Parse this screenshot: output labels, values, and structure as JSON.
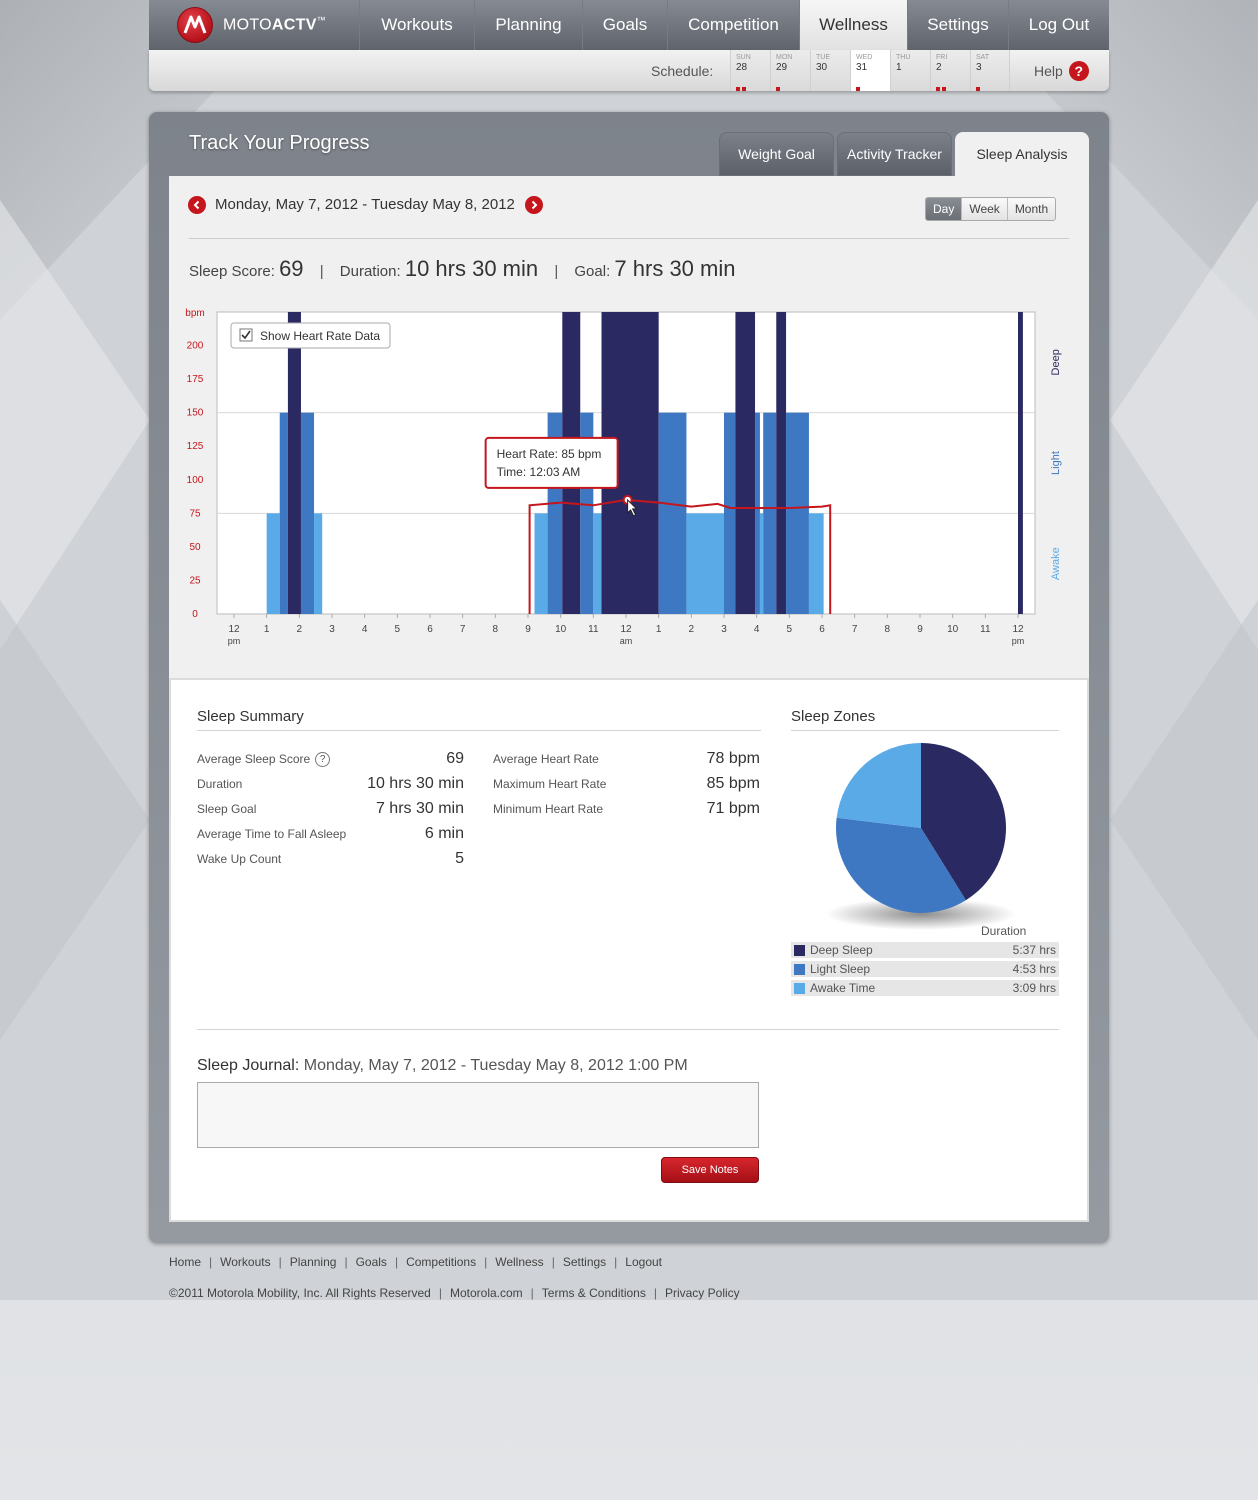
{
  "brand": {
    "name_prefix": "MOTO",
    "name_bold": "ACTV",
    "trademark": "™"
  },
  "nav": {
    "items": [
      "Workouts",
      "Planning",
      "Goals",
      "Competition",
      "Wellness",
      "Settings",
      "Log Out"
    ],
    "active": "Wellness"
  },
  "schedule": {
    "label": "Schedule:",
    "days": [
      {
        "name": "SUN",
        "num": "28",
        "dots": 2
      },
      {
        "name": "MON",
        "num": "29",
        "dots": 1
      },
      {
        "name": "TUE",
        "num": "30",
        "dots": 0
      },
      {
        "name": "WED",
        "num": "31",
        "dots": 1,
        "today": true
      },
      {
        "name": "THU",
        "num": "1",
        "dots": 0
      },
      {
        "name": "FRI",
        "num": "2",
        "dots": 2
      },
      {
        "name": "SAT",
        "num": "3",
        "dots": 1
      }
    ],
    "help_label": "Help",
    "help_icon": "?"
  },
  "page": {
    "title": "Track Your Progress",
    "tabs": [
      "Weight Goal",
      "Activity Tracker",
      "Sleep Analysis"
    ],
    "active_tab": "Sleep Analysis"
  },
  "date_range": "Monday, May 7, 2012 - Tuesday May 8, 2012",
  "periods": [
    "Day",
    "Week",
    "Month"
  ],
  "active_period": "Day",
  "stats": {
    "score_label": "Sleep Score:",
    "score_value": "69",
    "duration_label": "Duration:",
    "duration_value": "10 hrs 30 min",
    "goal_label": "Goal:",
    "goal_value": "7 hrs 30 min",
    "separator": "|"
  },
  "chart_data": {
    "type": "bar",
    "y_axis_label": "bpm",
    "y_ticks": [
      0,
      25,
      50,
      75,
      100,
      125,
      150,
      175,
      200
    ],
    "ylim": [
      0,
      225
    ],
    "x_ticks": [
      "12",
      "1",
      "2",
      "3",
      "4",
      "5",
      "6",
      "7",
      "8",
      "9",
      "10",
      "11",
      "12",
      "1",
      "2",
      "3",
      "4",
      "5",
      "6",
      "7",
      "8",
      "9",
      "10",
      "11",
      "12"
    ],
    "x_subtitles": {
      "0": "pm",
      "12": "am",
      "24": "pm"
    },
    "zones": [
      "Awake",
      "Light",
      "Deep"
    ],
    "zone_levels": {
      "Awake": 1,
      "Light": 2,
      "Deep": 3
    },
    "colors": {
      "Awake": "#5aaae8",
      "Light": "#3e78c2",
      "Deep": "#2a2962",
      "heart": "#c4161c"
    },
    "segments": [
      {
        "start": 1.0,
        "end": 1.4,
        "zone": "Awake"
      },
      {
        "start": 1.4,
        "end": 1.65,
        "zone": "Light"
      },
      {
        "start": 1.65,
        "end": 2.05,
        "zone": "Deep"
      },
      {
        "start": 2.05,
        "end": 2.45,
        "zone": "Light"
      },
      {
        "start": 2.45,
        "end": 2.7,
        "zone": "Awake"
      },
      {
        "start": 9.2,
        "end": 9.6,
        "zone": "Awake"
      },
      {
        "start": 9.6,
        "end": 10.05,
        "zone": "Light"
      },
      {
        "start": 10.05,
        "end": 10.6,
        "zone": "Deep"
      },
      {
        "start": 10.6,
        "end": 11.0,
        "zone": "Light"
      },
      {
        "start": 11.0,
        "end": 11.25,
        "zone": "Awake"
      },
      {
        "start": 11.25,
        "end": 13.0,
        "zone": "Deep"
      },
      {
        "start": 13.0,
        "end": 13.85,
        "zone": "Light"
      },
      {
        "start": 13.85,
        "end": 15.0,
        "zone": "Awake"
      },
      {
        "start": 15.0,
        "end": 15.35,
        "zone": "Light"
      },
      {
        "start": 15.35,
        "end": 15.95,
        "zone": "Deep"
      },
      {
        "start": 15.95,
        "end": 16.1,
        "zone": "Light"
      },
      {
        "start": 16.1,
        "end": 16.2,
        "zone": "Awake"
      },
      {
        "start": 16.2,
        "end": 16.6,
        "zone": "Light"
      },
      {
        "start": 16.6,
        "end": 16.9,
        "zone": "Deep"
      },
      {
        "start": 16.9,
        "end": 17.6,
        "zone": "Light"
      },
      {
        "start": 17.6,
        "end": 18.05,
        "zone": "Awake"
      },
      {
        "start": 24.0,
        "end": 24.15,
        "zone": "Deep"
      }
    ],
    "heart_rate": {
      "x": [
        9.05,
        9.05,
        10.0,
        11.0,
        12.0,
        13.0,
        14.0,
        14.8,
        15.2,
        16.0,
        17.0,
        18.0,
        18.25,
        18.25
      ],
      "y": [
        0,
        81,
        83,
        81,
        85,
        83,
        80,
        82,
        79,
        79,
        79,
        80,
        81,
        0
      ]
    },
    "show_heart_rate_label": "Show Heart Rate Data",
    "show_heart_rate_checked": true,
    "tooltip": {
      "heart_rate_label": "Heart Rate:",
      "heart_rate_value": "85 bpm",
      "time_label": "Time:",
      "time_value": "12:03 AM",
      "x": 12.05,
      "y": 85
    }
  },
  "summary": {
    "title": "Sleep Summary",
    "left": [
      {
        "label": "Average Sleep Score",
        "value": "69",
        "help": true
      },
      {
        "label": "Duration",
        "value": "10 hrs 30 min"
      },
      {
        "label": "Sleep Goal",
        "value": "7 hrs 30 min"
      },
      {
        "label": "Average Time to Fall Asleep",
        "value": "6 min"
      },
      {
        "label": "Wake Up Count",
        "value": "5"
      }
    ],
    "right": [
      {
        "label": "Average Heart Rate",
        "value": "78 bpm"
      },
      {
        "label": "Maximum Heart Rate",
        "value": "85 bpm"
      },
      {
        "label": "Minimum Heart Rate",
        "value": "71 bpm"
      }
    ]
  },
  "zones": {
    "title": "Sleep Zones",
    "duration_header": "Duration",
    "items": [
      {
        "name": "Deep Sleep",
        "duration": "5:37 hrs",
        "minutes": 337,
        "color": "#2a2962"
      },
      {
        "name": "Light Sleep",
        "duration": "4:53 hrs",
        "minutes": 293,
        "color": "#3e78c2"
      },
      {
        "name": "Awake Time",
        "duration": "3:09 hrs",
        "minutes": 189,
        "color": "#5aaae8"
      }
    ]
  },
  "journal": {
    "title_label": "Sleep Journal:",
    "title_date": "Monday, May 7, 2012 - Tuesday May 8, 2012 1:00 PM",
    "value": "",
    "save_label": "Save Notes"
  },
  "footer": {
    "links": [
      "Home",
      "Workouts",
      "Planning",
      "Goals",
      "Competitions",
      "Wellness",
      "Settings",
      "Logout"
    ],
    "copyright": "©2011 Motorola Mobility, Inc. All Rights Reserved",
    "legal_links": [
      "Motorola.com",
      "Terms & Conditions",
      "Privacy Policy"
    ],
    "separator": "|"
  }
}
